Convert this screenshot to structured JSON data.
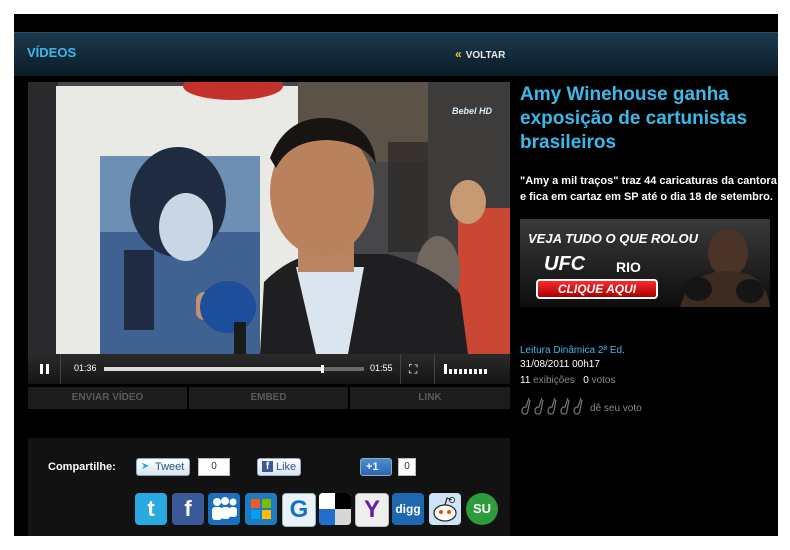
{
  "header": {
    "title": "VÍDEOS",
    "back_label": "VOLTAR",
    "accent": "#3bb9ea"
  },
  "player": {
    "current_time": "01:36",
    "total_time": "01:55",
    "progress": 0.84,
    "volume_bars": 9,
    "watermark": "Bebel HD",
    "tabs": [
      "ENVIAR VÍDEO",
      "EMBED",
      "LINK"
    ]
  },
  "share": {
    "label": "Compartilhe:",
    "tweet_label": "Tweet",
    "tweet_count": "0",
    "like_label": "Like",
    "plusone_label": "+1",
    "plusone_count": "0",
    "services": [
      {
        "name": "twitter",
        "glyph": "t",
        "color": "#2aa8e0"
      },
      {
        "name": "facebook",
        "glyph": "f",
        "color": "#3b5998"
      },
      {
        "name": "myspace",
        "glyph": "",
        "color": "#1a6fc1"
      },
      {
        "name": "windows-live",
        "glyph": "",
        "color": "#1e7bc0"
      },
      {
        "name": "google",
        "glyph": "G",
        "color": "#1570c9"
      },
      {
        "name": "delicious",
        "glyph": "",
        "color": "#ffffff"
      },
      {
        "name": "yahoo",
        "glyph": "Y",
        "color": "#6b1aa5"
      },
      {
        "name": "digg",
        "glyph": "digg",
        "color": "#1f68b0"
      },
      {
        "name": "reddit",
        "glyph": "",
        "color": "#cee3f8"
      },
      {
        "name": "stumbleupon",
        "glyph": "SU",
        "color": "#2e9b3c"
      }
    ]
  },
  "article": {
    "title": "Amy Winehouse ganha exposição de cartunistas brasileiros",
    "description": "\"Amy a mil traços\" traz 44 caricaturas da cantora e fica em cartaz em SP até o dia 18 de setembro."
  },
  "ad": {
    "headline": "VEJA TUDO O QUE ROLOU",
    "brand": "UFC",
    "brand_suffix": "RIO",
    "cta": "CLIQUE AQUI"
  },
  "meta": {
    "program": "Leitura Dinâmica 2ª Ed.",
    "datetime": "31/08/2011 00h17",
    "views": "11",
    "views_label": "exibições",
    "votes": "0",
    "votes_label": "votos",
    "rating_label": "dê seu voto",
    "star_count": 5
  }
}
